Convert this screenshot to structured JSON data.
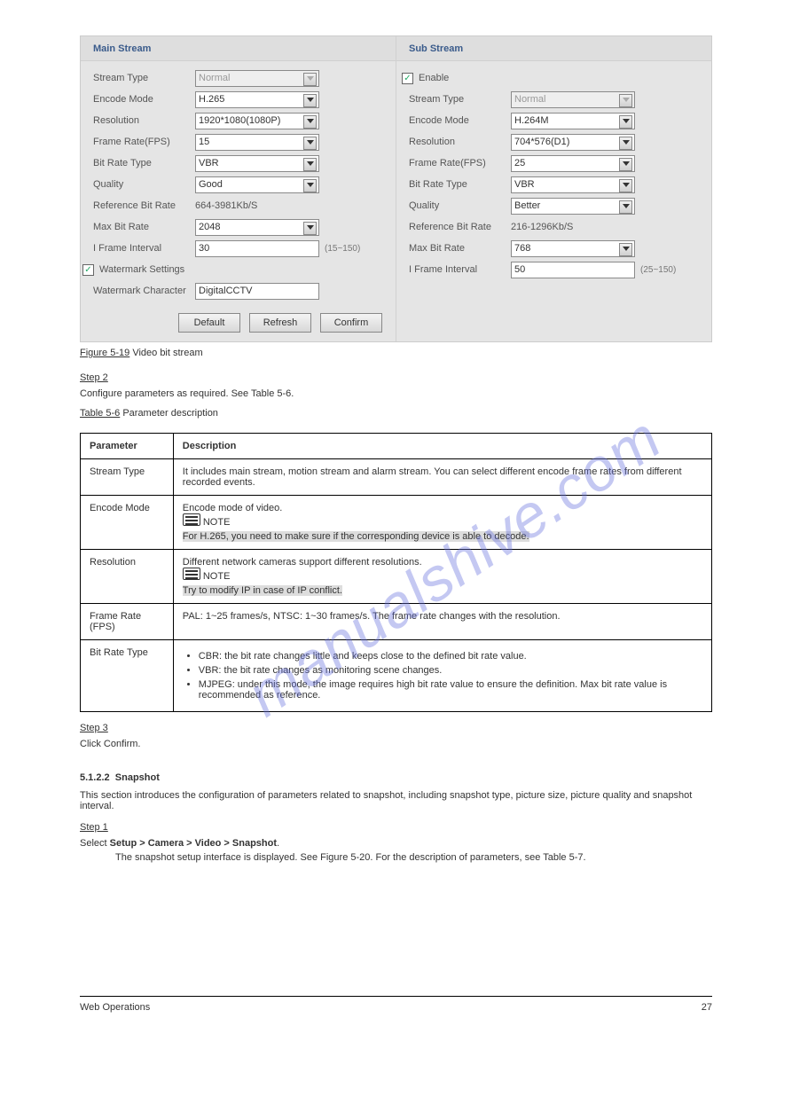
{
  "main": {
    "title": "Main Stream",
    "streamTypeLabel": "Stream Type",
    "streamType": "Normal",
    "encodeModeLabel": "Encode Mode",
    "encodeMode": "H.265",
    "resolutionLabel": "Resolution",
    "resolution": "1920*1080(1080P)",
    "fpsLabel": "Frame Rate(FPS)",
    "fps": "15",
    "bitRateTypeLabel": "Bit Rate Type",
    "bitRateType": "VBR",
    "qualityLabel": "Quality",
    "quality": "Good",
    "refBitRateLabel": "Reference Bit Rate",
    "refBitRate": "664-3981Kb/S",
    "maxBitRateLabel": "Max Bit Rate",
    "maxBitRate": "2048",
    "iFrameLabel": "I Frame Interval",
    "iFrame": "30",
    "iFrameRange": "(15~150)",
    "watermarkLabel": "Watermark Settings",
    "watermarkCharLabel": "Watermark Character",
    "watermarkChar": "DigitalCCTV"
  },
  "sub": {
    "title": "Sub Stream",
    "enable": "Enable",
    "streamTypeLabel": "Stream Type",
    "streamType": "Normal",
    "encodeModeLabel": "Encode Mode",
    "encodeMode": "H.264M",
    "resolutionLabel": "Resolution",
    "resolution": "704*576(D1)",
    "fpsLabel": "Frame Rate(FPS)",
    "fps": "25",
    "bitRateTypeLabel": "Bit Rate Type",
    "bitRateType": "VBR",
    "qualityLabel": "Quality",
    "quality": "Better",
    "refBitRateLabel": "Reference Bit Rate",
    "refBitRate": "216-1296Kb/S",
    "maxBitRateLabel": "Max Bit Rate",
    "maxBitRate": "768",
    "iFrameLabel": "I Frame Interval",
    "iFrame": "50",
    "iFrameRange": "(25~150)"
  },
  "buttons": {
    "default": "Default",
    "refresh": "Refresh",
    "confirm": "Confirm"
  },
  "figCaption": "Figure 5-19",
  "figCaptionText": " Video bit stream",
  "table": {
    "caption": "Table 5-6",
    "captionText": " Parameter description",
    "hParam": "Parameter",
    "hDesc": "Description",
    "rows": [
      {
        "p": "Stream Type",
        "d": "It includes main stream, motion stream and alarm stream. You can select different encode frame rates from different recorded events."
      },
      {
        "p": "Encode Mode",
        "d": "Encode mode of video.",
        "note": "For H.265, you need to make sure if the corresponding device is able to decode.",
        "noteHL": true
      },
      {
        "p": "Resolution",
        "d": "Different network cameras support different resolutions.",
        "note": "Try to modify IP in case of IP conflict.",
        "noteHL": true
      },
      {
        "p": "Frame Rate (FPS)",
        "d": "PAL: 1~25 frames/s, NTSC: 1~30 frames/s. The frame rate changes with the resolution."
      },
      {
        "p": "Bit Rate Type",
        "d": "",
        "bullets": [
          "CBR: the bit rate changes little and keeps close to the defined bit rate value.",
          "VBR: the bit rate changes as monitoring scene changes.",
          "MJPEG: under this mode, the image requires high bit rate value to ensure the definition. Max bit rate value is recommended as reference."
        ]
      }
    ]
  },
  "step3": "Step 3",
  "step3Text": "Click Confirm.",
  "sectionNum": "5.1.2.2",
  "sectionTitle": "Snapshot",
  "sectionDesc": "This section introduces the configuration of parameters related to snapshot, including snapshot type, picture size, picture quality and snapshot interval.",
  "step1": "Step 1",
  "step1a": "Select ",
  "step1b": "Setup > Camera > Video > Snapshot",
  "step1c": "The snapshot setup interface is displayed. See Figure 5-20. For the description of parameters, see Table 5-7.",
  "footerLeft": "Web Operations",
  "footerRight": "27"
}
